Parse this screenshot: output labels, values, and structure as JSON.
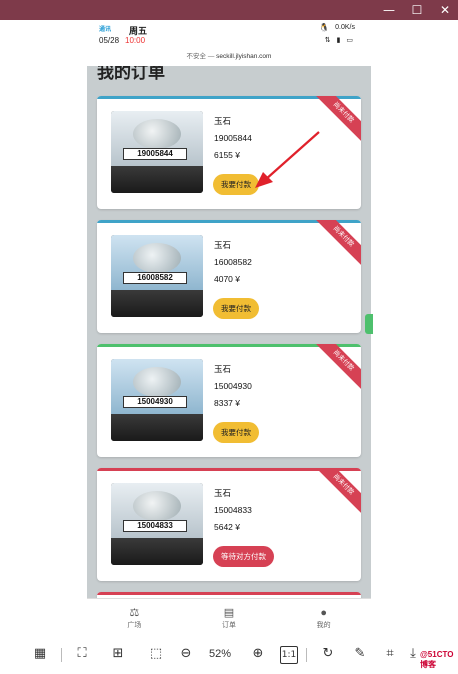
{
  "window": {
    "minimize_icon": "minimize-icon",
    "maximize_icon": "maximize-icon",
    "close_icon": "close-icon"
  },
  "status_bar": {
    "logo": "通讯",
    "weekday": "周五",
    "date": "05/28",
    "time": "10:00",
    "speed": "0.0K/s",
    "signal_icons": "⇅ ▮ ▭",
    "qq_icon": "🐧"
  },
  "url_bar": {
    "security": "不安全 —",
    "host": "seckill.jlyishan.com"
  },
  "page": {
    "title": "我的订单"
  },
  "orders": [
    {
      "name": "玉石",
      "code": "19005844",
      "price": "6155 ¥",
      "button": "我要付款",
      "ribbon": "尚未付款",
      "label": "19005844",
      "stripe": "#3fa3c8"
    },
    {
      "name": "玉石",
      "code": "16008582",
      "price": "4070 ¥",
      "button": "我要付款",
      "ribbon": "尚未付款",
      "label": "16008582",
      "stripe": "#3fa3c8"
    },
    {
      "name": "玉石",
      "code": "15004930",
      "price": "8337 ¥",
      "button": "我要付款",
      "ribbon": "尚未付款",
      "label": "15004930",
      "stripe": "#4ec06d"
    },
    {
      "name": "玉石",
      "code": "15004833",
      "price": "5642 ¥",
      "button": "等待对方付款",
      "ribbon": "尚未付款",
      "label": "15004833",
      "stripe": "#d64154"
    }
  ],
  "bottom_nav": [
    {
      "label": "广场",
      "icon": "scale-icon"
    },
    {
      "label": "订单",
      "icon": "list-icon"
    },
    {
      "label": "我的",
      "icon": "user-icon"
    }
  ],
  "toolbar": {
    "zoom": "52%",
    "one_to_one": "1:1",
    "watermark": "@51CTO博客"
  },
  "colors": {
    "title_bar": "#7e3a4a",
    "pay_button": "#f1bd33",
    "wait_button": "#d64154",
    "ribbon": "#d64154"
  }
}
